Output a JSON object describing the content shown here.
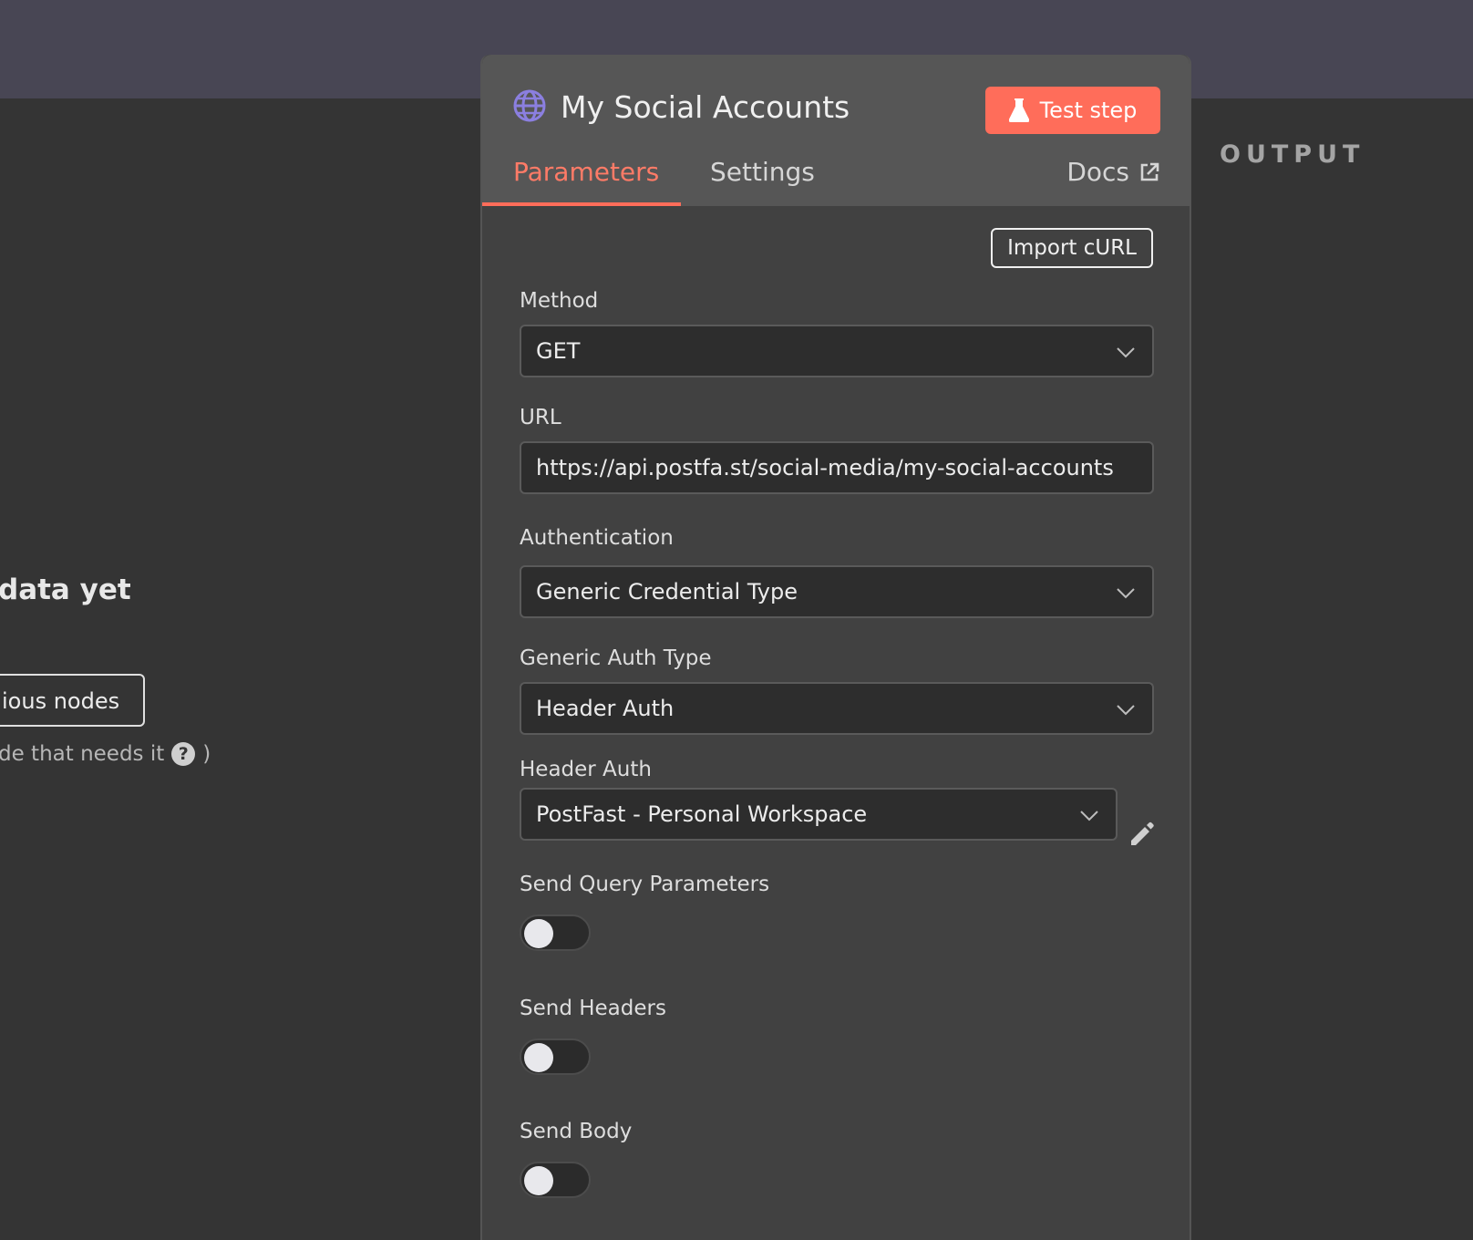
{
  "left": {
    "title": "data yet",
    "button": "ious nodes",
    "hint_text": "de that needs it",
    "hint_close": ")",
    "help_glyph": "?"
  },
  "output": {
    "label": "OUTPUT"
  },
  "node": {
    "title": "My Social Accounts",
    "test_step": "Test step",
    "tabs": {
      "parameters": "Parameters",
      "settings": "Settings"
    },
    "docs": "Docs",
    "import_curl": "Import cURL",
    "fields": {
      "method": {
        "label": "Method",
        "value": "GET"
      },
      "url": {
        "label": "URL",
        "value": "https://api.postfa.st/social-media/my-social-accounts"
      },
      "authentication": {
        "label": "Authentication",
        "value": "Generic Credential Type"
      },
      "generic_auth_type": {
        "label": "Generic Auth Type",
        "value": "Header Auth"
      },
      "header_auth": {
        "label": "Header Auth",
        "value": "PostFast - Personal Workspace"
      }
    },
    "toggles": {
      "query": {
        "label": "Send Query Parameters",
        "on": false
      },
      "headers": {
        "label": "Send Headers",
        "on": false
      },
      "body": {
        "label": "Send Body",
        "on": false
      }
    }
  },
  "colors": {
    "accent": "#ff6d5a",
    "globe": "#8b7fe0"
  }
}
